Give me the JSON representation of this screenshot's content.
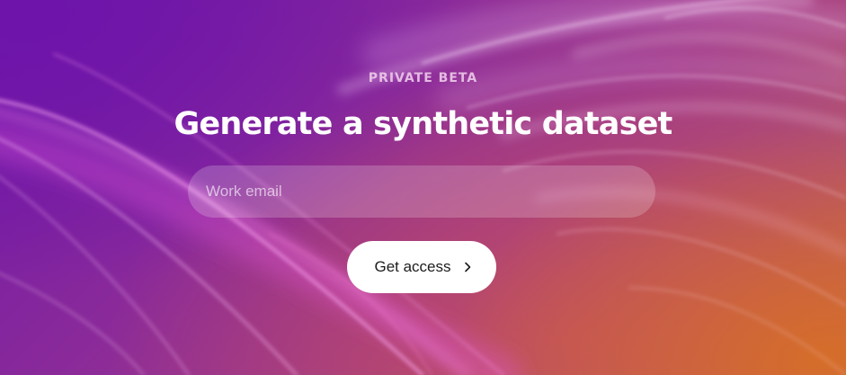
{
  "hero": {
    "eyebrow": "PRIVATE BETA",
    "title": "Generate a synthetic dataset",
    "email_placeholder": "Work email",
    "email_value": "",
    "cta_label": "Get access",
    "cta_icon": "chevron-right-icon"
  },
  "colors": {
    "gradient_start": "#6e18a8",
    "gradient_mid": "#a23a88",
    "gradient_end": "#c26848",
    "button_bg": "#ffffff",
    "button_text": "#1c1c1c",
    "title_text": "#ffffff"
  }
}
